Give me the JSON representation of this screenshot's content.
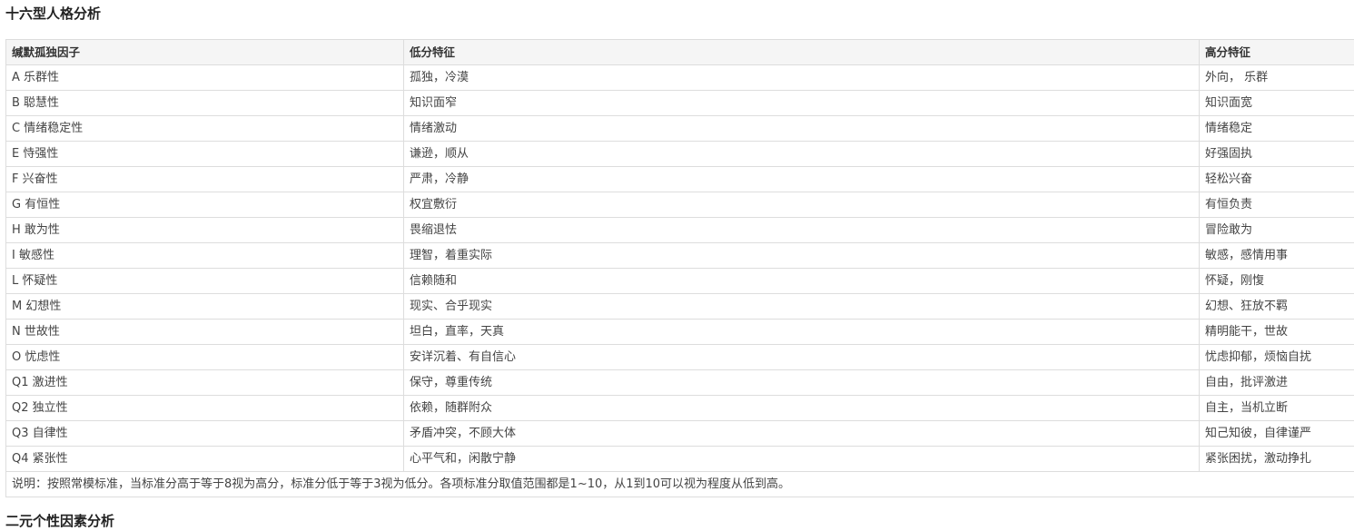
{
  "section_title": "十六型人格分析",
  "next_section_title": "二元个性因素分析",
  "table": {
    "headers": [
      "缄默孤独因子",
      "低分特征",
      "高分特征"
    ],
    "rows": [
      [
        "A 乐群性",
        "孤独，冷漠",
        "外向， 乐群"
      ],
      [
        "B 聪慧性",
        "知识面窄",
        "知识面宽"
      ],
      [
        "C 情绪稳定性",
        "情绪激动",
        "情绪稳定"
      ],
      [
        "E 恃强性",
        "谦逊，顺从",
        "好强固执"
      ],
      [
        "F 兴奋性",
        "严肃，冷静",
        "轻松兴奋"
      ],
      [
        "G 有恒性",
        "权宜敷衍",
        "有恒负责"
      ],
      [
        "H 敢为性",
        "畏缩退怯",
        "冒险敢为"
      ],
      [
        "I 敏感性",
        "理智，着重实际",
        "敏感，感情用事"
      ],
      [
        "L 怀疑性",
        "信赖随和",
        "怀疑，刚愎"
      ],
      [
        "M 幻想性",
        "现实、合乎现实",
        "幻想、狂放不羁"
      ],
      [
        "N 世故性",
        "坦白，直率，天真",
        "精明能干，世故"
      ],
      [
        "O 忧虑性",
        "安详沉着、有自信心",
        "忧虑抑郁，烦恼自扰"
      ],
      [
        "Q1 激进性",
        "保守，尊重传统",
        "自由，批评激进"
      ],
      [
        "Q2 独立性",
        "依赖，随群附众",
        "自主，当机立断"
      ],
      [
        "Q3 自律性",
        "矛盾冲突，不顾大体",
        "知己知彼，自律谨严"
      ],
      [
        "Q4 紧张性",
        "心平气和，闲散宁静",
        "紧张困扰，激动挣扎"
      ]
    ],
    "note": "说明：按照常模标准，当标准分高于等于8视为高分，标准分低于等于3视为低分。各项标准分取值范围都是1~10，从1到10可以视为程度从低到高。"
  }
}
